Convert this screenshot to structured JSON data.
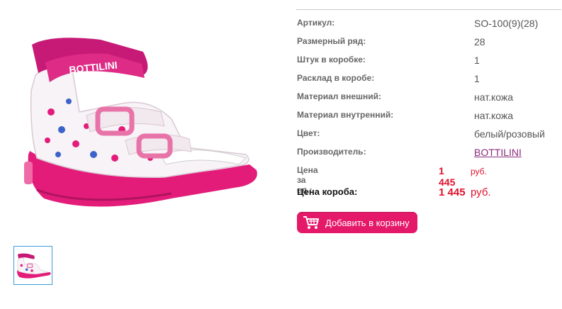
{
  "product": {
    "brand_on_strap": "BOTTILINI"
  },
  "specs": [
    {
      "label": "Артикул:",
      "value": "SO-100(9)(28)",
      "link": false
    },
    {
      "label": "Размерный ряд:",
      "value": "28",
      "link": false
    },
    {
      "label": "Штук в коробке:",
      "value": "1",
      "link": false
    },
    {
      "label": "Расклад в коробе:",
      "value": "1",
      "link": false
    },
    {
      "label": "Материал внешний:",
      "value": "нат.кожа",
      "link": false
    },
    {
      "label": "Материал внутренний:",
      "value": "нат.кожа",
      "link": false
    },
    {
      "label": "Цвет:",
      "value": "белый/розовый",
      "link": false
    },
    {
      "label": "Производитель:",
      "value": "BOTTILINI",
      "link": true
    }
  ],
  "price_unit": {
    "label": "Цена за ед.:",
    "amount": "1 445",
    "currency": "руб."
  },
  "price_box": {
    "label": "Цена короба:",
    "amount": "1 445",
    "currency": "руб."
  },
  "cart_button": {
    "label": "Добавить в корзину",
    "icon": "shopping-cart-icon"
  },
  "colors": {
    "accent": "#e5196a",
    "price": "#e0122d",
    "link": "#8a2a7c",
    "thumb_border": "#3aa0d8"
  }
}
